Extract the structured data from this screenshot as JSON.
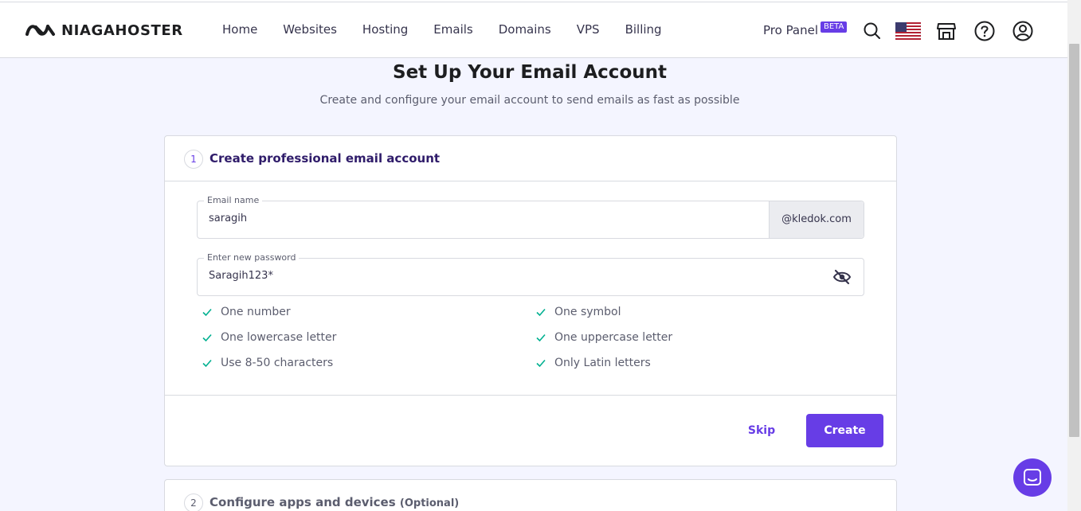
{
  "brand": {
    "name": "NIAGAHOSTER"
  },
  "nav": {
    "items": [
      "Home",
      "Websites",
      "Hosting",
      "Emails",
      "Domains",
      "VPS",
      "Billing"
    ]
  },
  "header": {
    "pro_panel": "Pro Panel",
    "beta_badge": "BETA",
    "icons": [
      "search-icon",
      "us-flag-icon",
      "store-icon",
      "help-icon",
      "account-icon"
    ]
  },
  "page": {
    "title": "Set Up Your Email Account",
    "subtitle": "Create and configure your email account to send emails as fast as possible"
  },
  "step1": {
    "number": "1",
    "title": "Create professional email account",
    "email_field": {
      "label": "Email name",
      "value": "saragih",
      "domain_suffix": "@kledok.com"
    },
    "password_field": {
      "label": "Enter new password",
      "value": "Saragih123*"
    },
    "rules": {
      "left": [
        "One number",
        "One lowercase letter",
        "Use 8-50 characters"
      ],
      "right": [
        "One symbol",
        "One uppercase letter",
        "Only Latin letters"
      ]
    },
    "skip_label": "Skip",
    "create_label": "Create"
  },
  "step2": {
    "number": "2",
    "title": "Configure apps and devices",
    "optional": "(Optional)"
  },
  "colors": {
    "accent": "#673de6",
    "check": "#00b090",
    "page_bg": "#f4f5ff"
  }
}
